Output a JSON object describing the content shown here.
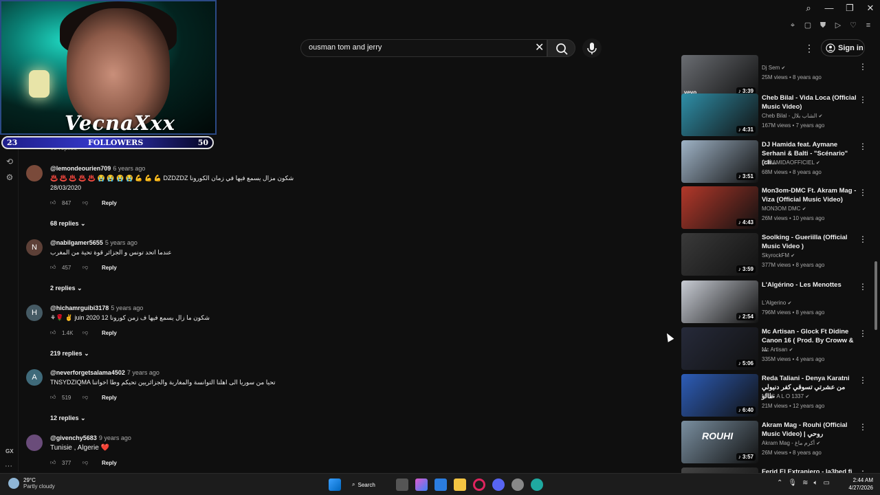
{
  "search": {
    "value": "ousman tom and jerry"
  },
  "header": {
    "signin_label": "Sign in"
  },
  "webcam": {
    "name": "VecnaXxx",
    "followers_label": "FOLLOWERS",
    "followers_current": "23",
    "followers_goal": "50"
  },
  "comments": [
    {
      "user": "@lemondeourien709",
      "time": "6 years ago",
      "text": "♨️ ♨️ ♨️ ♨️ ♨️ 😭 😭 😭 😭 💪 💪 💪 DZDZDZ شكون مزال يسمع فيها في زمان الكورونا",
      "text2": "28/03/2020",
      "likes": "847",
      "reply_label": "Reply",
      "replies": "68 replies"
    },
    {
      "user": "@nabilgamer5655",
      "time": "5 years ago",
      "avatar_letter": "N",
      "text": "عندما اتحد تونس و الجزائر قوة تحية من المغرب",
      "likes": "457",
      "reply_label": "Reply",
      "replies": "2 replies"
    },
    {
      "user": "@hichamrguibi3178",
      "time": "5 years ago",
      "avatar_letter": "H",
      "text": "⚘🌹 ✌ juin 2020 12 شكون ما زال يسمع فيها ف زمن كورونا",
      "likes": "1.4K",
      "reply_label": "Reply",
      "replies": "219 replies"
    },
    {
      "user": "@neverforgetsalama4502",
      "time": "7 years ago",
      "avatar_letter": "A",
      "text": "TNSYDZIQMA تحيا من سوريا الى اهلنا التوانسة والمغاربة والجزائريين تحيكم وطا اخواتنا",
      "likes": "519",
      "reply_label": "Reply",
      "replies": "12 replies"
    },
    {
      "user": "@givenchy5683",
      "time": "9 years ago",
      "text": "Tunisie , Algerie ❤️",
      "likes": "377",
      "reply_label": "Reply"
    }
  ],
  "sidebar_videos": [
    {
      "title": "",
      "channel": "Dj Sem",
      "views": "25M views",
      "age": "8 years ago",
      "duration": "3:39",
      "thumb_color": "#6a6d72",
      "badge": "vevo"
    },
    {
      "title": "Cheb Bilal - Vida Loca (Official Music Video)",
      "channel": "Cheb Bilal - الشاب بلال",
      "views": "167M views",
      "age": "7 years ago",
      "duration": "4:31",
      "thumb_color": "#2f8fa8"
    },
    {
      "title": "DJ Hamida feat. Aymane Serhani & Balti - \"Scénario\" (cli...",
      "channel": "DJHAMIDAOFFICIEL",
      "views": "68M views",
      "age": "8 years ago",
      "duration": "3:51",
      "thumb_color": "#9fb3c6"
    },
    {
      "title": "Mon3om-DMC Ft. Akram Mag - Viza (Official Music Video)",
      "channel": "MON3OM DMC",
      "views": "26M views",
      "age": "10 years ago",
      "duration": "4:43",
      "thumb_color": "#b3382a"
    },
    {
      "title": "Soolking - Gueriilla (Official Music Video )",
      "channel": "SkyrockFM",
      "views": "377M views",
      "age": "8 years ago",
      "duration": "3:59",
      "thumb_color": "#3a3a3a"
    },
    {
      "title": "L'Algérino - Les Menottes",
      "channel": "L'Algerino",
      "views": "796M views",
      "age": "8 years ago",
      "duration": "2:54",
      "thumb_color": "#c8ccd4"
    },
    {
      "title": "Mc Artisan - Glock Ft Didine Canon 16 ( Prod. By Croww & ...",
      "channel": "Mc Artisan",
      "views": "335M views",
      "age": "4 years ago",
      "duration": "5:06",
      "thumb_color": "#262a3a"
    },
    {
      "title": "Reda Taliani - Denya Karatni من عشرتي تسوقي كفر دنيولي طالو",
      "channel": "M I G A L O 1337",
      "views": "21M views",
      "age": "12 years ago",
      "duration": "6:40",
      "thumb_color": "#2d5db8"
    },
    {
      "title": "Akram Mag - Rouhi (Official Music Video) | روحي",
      "channel": "Akram Mag - أكرم ماغ",
      "views": "26M views",
      "age": "8 years ago",
      "duration": "3:57",
      "thumb_color": "#7a8fa0",
      "overlay": "ROUHI"
    },
    {
      "title": "Ferid El Extraniero - la3bed fi",
      "channel": "",
      "views": "",
      "age": "",
      "duration": "",
      "thumb_color": "#444"
    }
  ],
  "taskbar": {
    "temp": "29°C",
    "weather": "Partly cloudy",
    "search_label": "Search",
    "time": "2:44 AM",
    "date": "4/27/2026"
  },
  "gx_label": "GX"
}
